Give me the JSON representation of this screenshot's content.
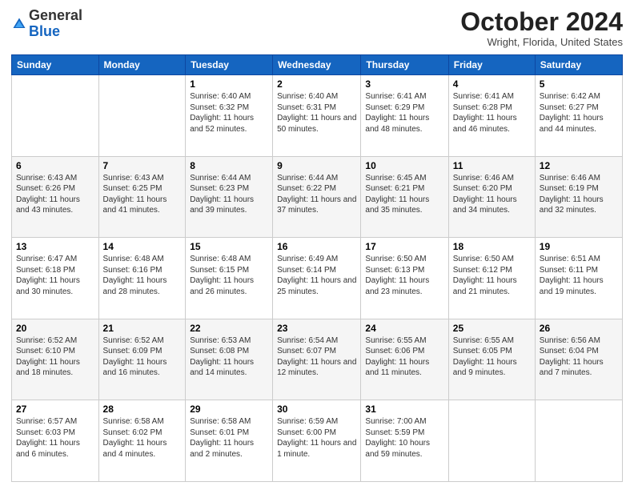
{
  "logo": {
    "general": "General",
    "blue": "Blue"
  },
  "header": {
    "month": "October 2024",
    "location": "Wright, Florida, United States"
  },
  "weekdays": [
    "Sunday",
    "Monday",
    "Tuesday",
    "Wednesday",
    "Thursday",
    "Friday",
    "Saturday"
  ],
  "weeks": [
    [
      {
        "day": "",
        "sunrise": "",
        "sunset": "",
        "daylight": ""
      },
      {
        "day": "",
        "sunrise": "",
        "sunset": "",
        "daylight": ""
      },
      {
        "day": "1",
        "sunrise": "Sunrise: 6:40 AM",
        "sunset": "Sunset: 6:32 PM",
        "daylight": "Daylight: 11 hours and 52 minutes."
      },
      {
        "day": "2",
        "sunrise": "Sunrise: 6:40 AM",
        "sunset": "Sunset: 6:31 PM",
        "daylight": "Daylight: 11 hours and 50 minutes."
      },
      {
        "day": "3",
        "sunrise": "Sunrise: 6:41 AM",
        "sunset": "Sunset: 6:29 PM",
        "daylight": "Daylight: 11 hours and 48 minutes."
      },
      {
        "day": "4",
        "sunrise": "Sunrise: 6:41 AM",
        "sunset": "Sunset: 6:28 PM",
        "daylight": "Daylight: 11 hours and 46 minutes."
      },
      {
        "day": "5",
        "sunrise": "Sunrise: 6:42 AM",
        "sunset": "Sunset: 6:27 PM",
        "daylight": "Daylight: 11 hours and 44 minutes."
      }
    ],
    [
      {
        "day": "6",
        "sunrise": "Sunrise: 6:43 AM",
        "sunset": "Sunset: 6:26 PM",
        "daylight": "Daylight: 11 hours and 43 minutes."
      },
      {
        "day": "7",
        "sunrise": "Sunrise: 6:43 AM",
        "sunset": "Sunset: 6:25 PM",
        "daylight": "Daylight: 11 hours and 41 minutes."
      },
      {
        "day": "8",
        "sunrise": "Sunrise: 6:44 AM",
        "sunset": "Sunset: 6:23 PM",
        "daylight": "Daylight: 11 hours and 39 minutes."
      },
      {
        "day": "9",
        "sunrise": "Sunrise: 6:44 AM",
        "sunset": "Sunset: 6:22 PM",
        "daylight": "Daylight: 11 hours and 37 minutes."
      },
      {
        "day": "10",
        "sunrise": "Sunrise: 6:45 AM",
        "sunset": "Sunset: 6:21 PM",
        "daylight": "Daylight: 11 hours and 35 minutes."
      },
      {
        "day": "11",
        "sunrise": "Sunrise: 6:46 AM",
        "sunset": "Sunset: 6:20 PM",
        "daylight": "Daylight: 11 hours and 34 minutes."
      },
      {
        "day": "12",
        "sunrise": "Sunrise: 6:46 AM",
        "sunset": "Sunset: 6:19 PM",
        "daylight": "Daylight: 11 hours and 32 minutes."
      }
    ],
    [
      {
        "day": "13",
        "sunrise": "Sunrise: 6:47 AM",
        "sunset": "Sunset: 6:18 PM",
        "daylight": "Daylight: 11 hours and 30 minutes."
      },
      {
        "day": "14",
        "sunrise": "Sunrise: 6:48 AM",
        "sunset": "Sunset: 6:16 PM",
        "daylight": "Daylight: 11 hours and 28 minutes."
      },
      {
        "day": "15",
        "sunrise": "Sunrise: 6:48 AM",
        "sunset": "Sunset: 6:15 PM",
        "daylight": "Daylight: 11 hours and 26 minutes."
      },
      {
        "day": "16",
        "sunrise": "Sunrise: 6:49 AM",
        "sunset": "Sunset: 6:14 PM",
        "daylight": "Daylight: 11 hours and 25 minutes."
      },
      {
        "day": "17",
        "sunrise": "Sunrise: 6:50 AM",
        "sunset": "Sunset: 6:13 PM",
        "daylight": "Daylight: 11 hours and 23 minutes."
      },
      {
        "day": "18",
        "sunrise": "Sunrise: 6:50 AM",
        "sunset": "Sunset: 6:12 PM",
        "daylight": "Daylight: 11 hours and 21 minutes."
      },
      {
        "day": "19",
        "sunrise": "Sunrise: 6:51 AM",
        "sunset": "Sunset: 6:11 PM",
        "daylight": "Daylight: 11 hours and 19 minutes."
      }
    ],
    [
      {
        "day": "20",
        "sunrise": "Sunrise: 6:52 AM",
        "sunset": "Sunset: 6:10 PM",
        "daylight": "Daylight: 11 hours and 18 minutes."
      },
      {
        "day": "21",
        "sunrise": "Sunrise: 6:52 AM",
        "sunset": "Sunset: 6:09 PM",
        "daylight": "Daylight: 11 hours and 16 minutes."
      },
      {
        "day": "22",
        "sunrise": "Sunrise: 6:53 AM",
        "sunset": "Sunset: 6:08 PM",
        "daylight": "Daylight: 11 hours and 14 minutes."
      },
      {
        "day": "23",
        "sunrise": "Sunrise: 6:54 AM",
        "sunset": "Sunset: 6:07 PM",
        "daylight": "Daylight: 11 hours and 12 minutes."
      },
      {
        "day": "24",
        "sunrise": "Sunrise: 6:55 AM",
        "sunset": "Sunset: 6:06 PM",
        "daylight": "Daylight: 11 hours and 11 minutes."
      },
      {
        "day": "25",
        "sunrise": "Sunrise: 6:55 AM",
        "sunset": "Sunset: 6:05 PM",
        "daylight": "Daylight: 11 hours and 9 minutes."
      },
      {
        "day": "26",
        "sunrise": "Sunrise: 6:56 AM",
        "sunset": "Sunset: 6:04 PM",
        "daylight": "Daylight: 11 hours and 7 minutes."
      }
    ],
    [
      {
        "day": "27",
        "sunrise": "Sunrise: 6:57 AM",
        "sunset": "Sunset: 6:03 PM",
        "daylight": "Daylight: 11 hours and 6 minutes."
      },
      {
        "day": "28",
        "sunrise": "Sunrise: 6:58 AM",
        "sunset": "Sunset: 6:02 PM",
        "daylight": "Daylight: 11 hours and 4 minutes."
      },
      {
        "day": "29",
        "sunrise": "Sunrise: 6:58 AM",
        "sunset": "Sunset: 6:01 PM",
        "daylight": "Daylight: 11 hours and 2 minutes."
      },
      {
        "day": "30",
        "sunrise": "Sunrise: 6:59 AM",
        "sunset": "Sunset: 6:00 PM",
        "daylight": "Daylight: 11 hours and 1 minute."
      },
      {
        "day": "31",
        "sunrise": "Sunrise: 7:00 AM",
        "sunset": "Sunset: 5:59 PM",
        "daylight": "Daylight: 10 hours and 59 minutes."
      },
      {
        "day": "",
        "sunrise": "",
        "sunset": "",
        "daylight": ""
      },
      {
        "day": "",
        "sunrise": "",
        "sunset": "",
        "daylight": ""
      }
    ]
  ]
}
